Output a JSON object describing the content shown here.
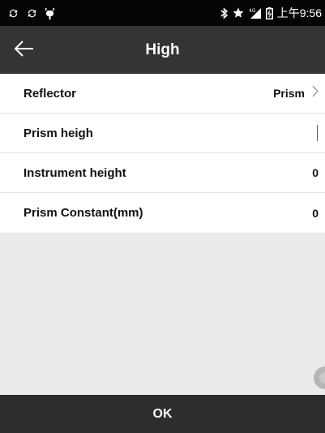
{
  "status_bar": {
    "left_icons": [
      "sync-icon",
      "sync-icon",
      "android-debug-icon"
    ],
    "right_icons": [
      "bluetooth-icon",
      "star-icon",
      "signal-4g-icon",
      "battery-icon"
    ],
    "time": "上午9:56"
  },
  "app_bar": {
    "back_icon": "arrow-left-icon",
    "title": "High"
  },
  "form": {
    "rows": [
      {
        "label": "Reflector",
        "value": "Prism",
        "trailing_icon": "chevron-right-icon"
      },
      {
        "label": "Prism heigh",
        "value": ""
      },
      {
        "label": "Instrument height",
        "value": "0"
      },
      {
        "label": "Prism Constant(mm)",
        "value": "0"
      }
    ]
  },
  "footer": {
    "ok_label": "OK"
  },
  "colors": {
    "status_bar_bg": "#050505",
    "app_bar_bg": "#343434",
    "footer_bg": "#2d2d2d",
    "form_bg": "#ffffff",
    "page_bg": "#ebebeb"
  }
}
